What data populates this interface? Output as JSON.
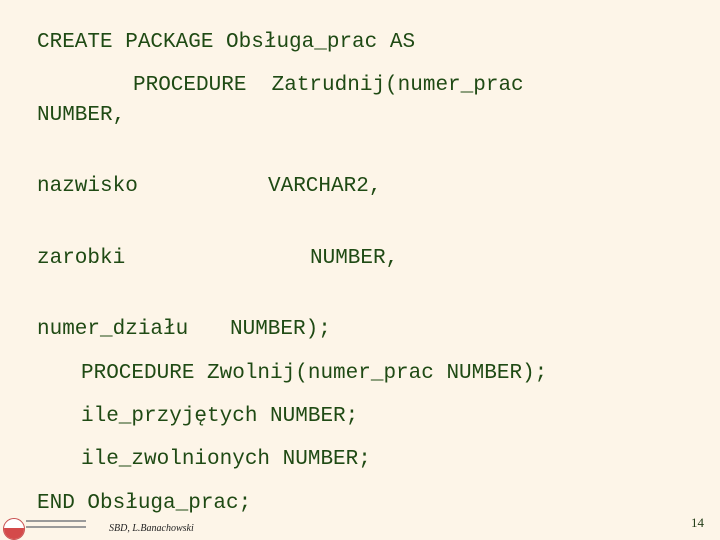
{
  "slide": {
    "code_lines": [
      "CREATE PACKAGE Obsługa_prac AS",
      "PROCEDURE  Zatrudnij(numer_prac",
      "NUMBER,",
      "nazwisko",
      "VARCHAR2,",
      "zarobki",
      "NUMBER,",
      "numer_działu",
      "NUMBER);",
      "PROCEDURE Zwolnij(numer_prac NUMBER);",
      "ile_przyjętych NUMBER;",
      "ile_zwolnionych NUMBER;",
      "END Obsługa_prac;"
    ],
    "footer_author": "SBD, L.Banachowski",
    "page_number": "14"
  }
}
